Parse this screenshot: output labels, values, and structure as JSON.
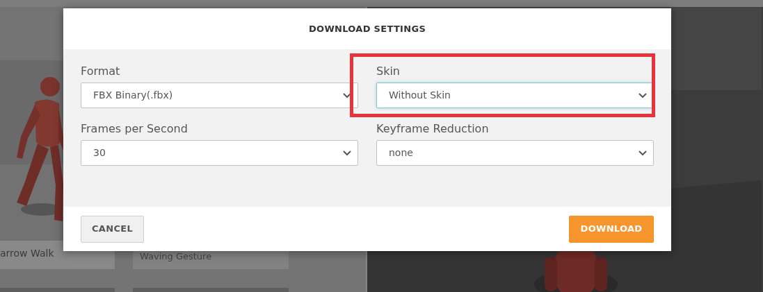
{
  "background": {
    "cards": [
      {
        "title": "arrow Walk",
        "kind": "picture"
      },
      {
        "title": "Waving Gesture"
      }
    ]
  },
  "dialog": {
    "title": "DOWNLOAD SETTINGS",
    "fields": [
      {
        "label": "Format",
        "value": "FBX Binary(.fbx)",
        "focused": false,
        "highlighted": false
      },
      {
        "label": "Skin",
        "value": "Without Skin",
        "focused": true,
        "highlighted": true
      },
      {
        "label": "Frames per Second",
        "value": "30",
        "focused": false,
        "highlighted": false
      },
      {
        "label": "Keyframe Reduction",
        "value": "none",
        "focused": false,
        "highlighted": false
      }
    ],
    "buttons": [
      {
        "label": "CANCEL",
        "kind": "secondary"
      },
      {
        "label": "DOWNLOAD",
        "kind": "primary"
      }
    ]
  }
}
